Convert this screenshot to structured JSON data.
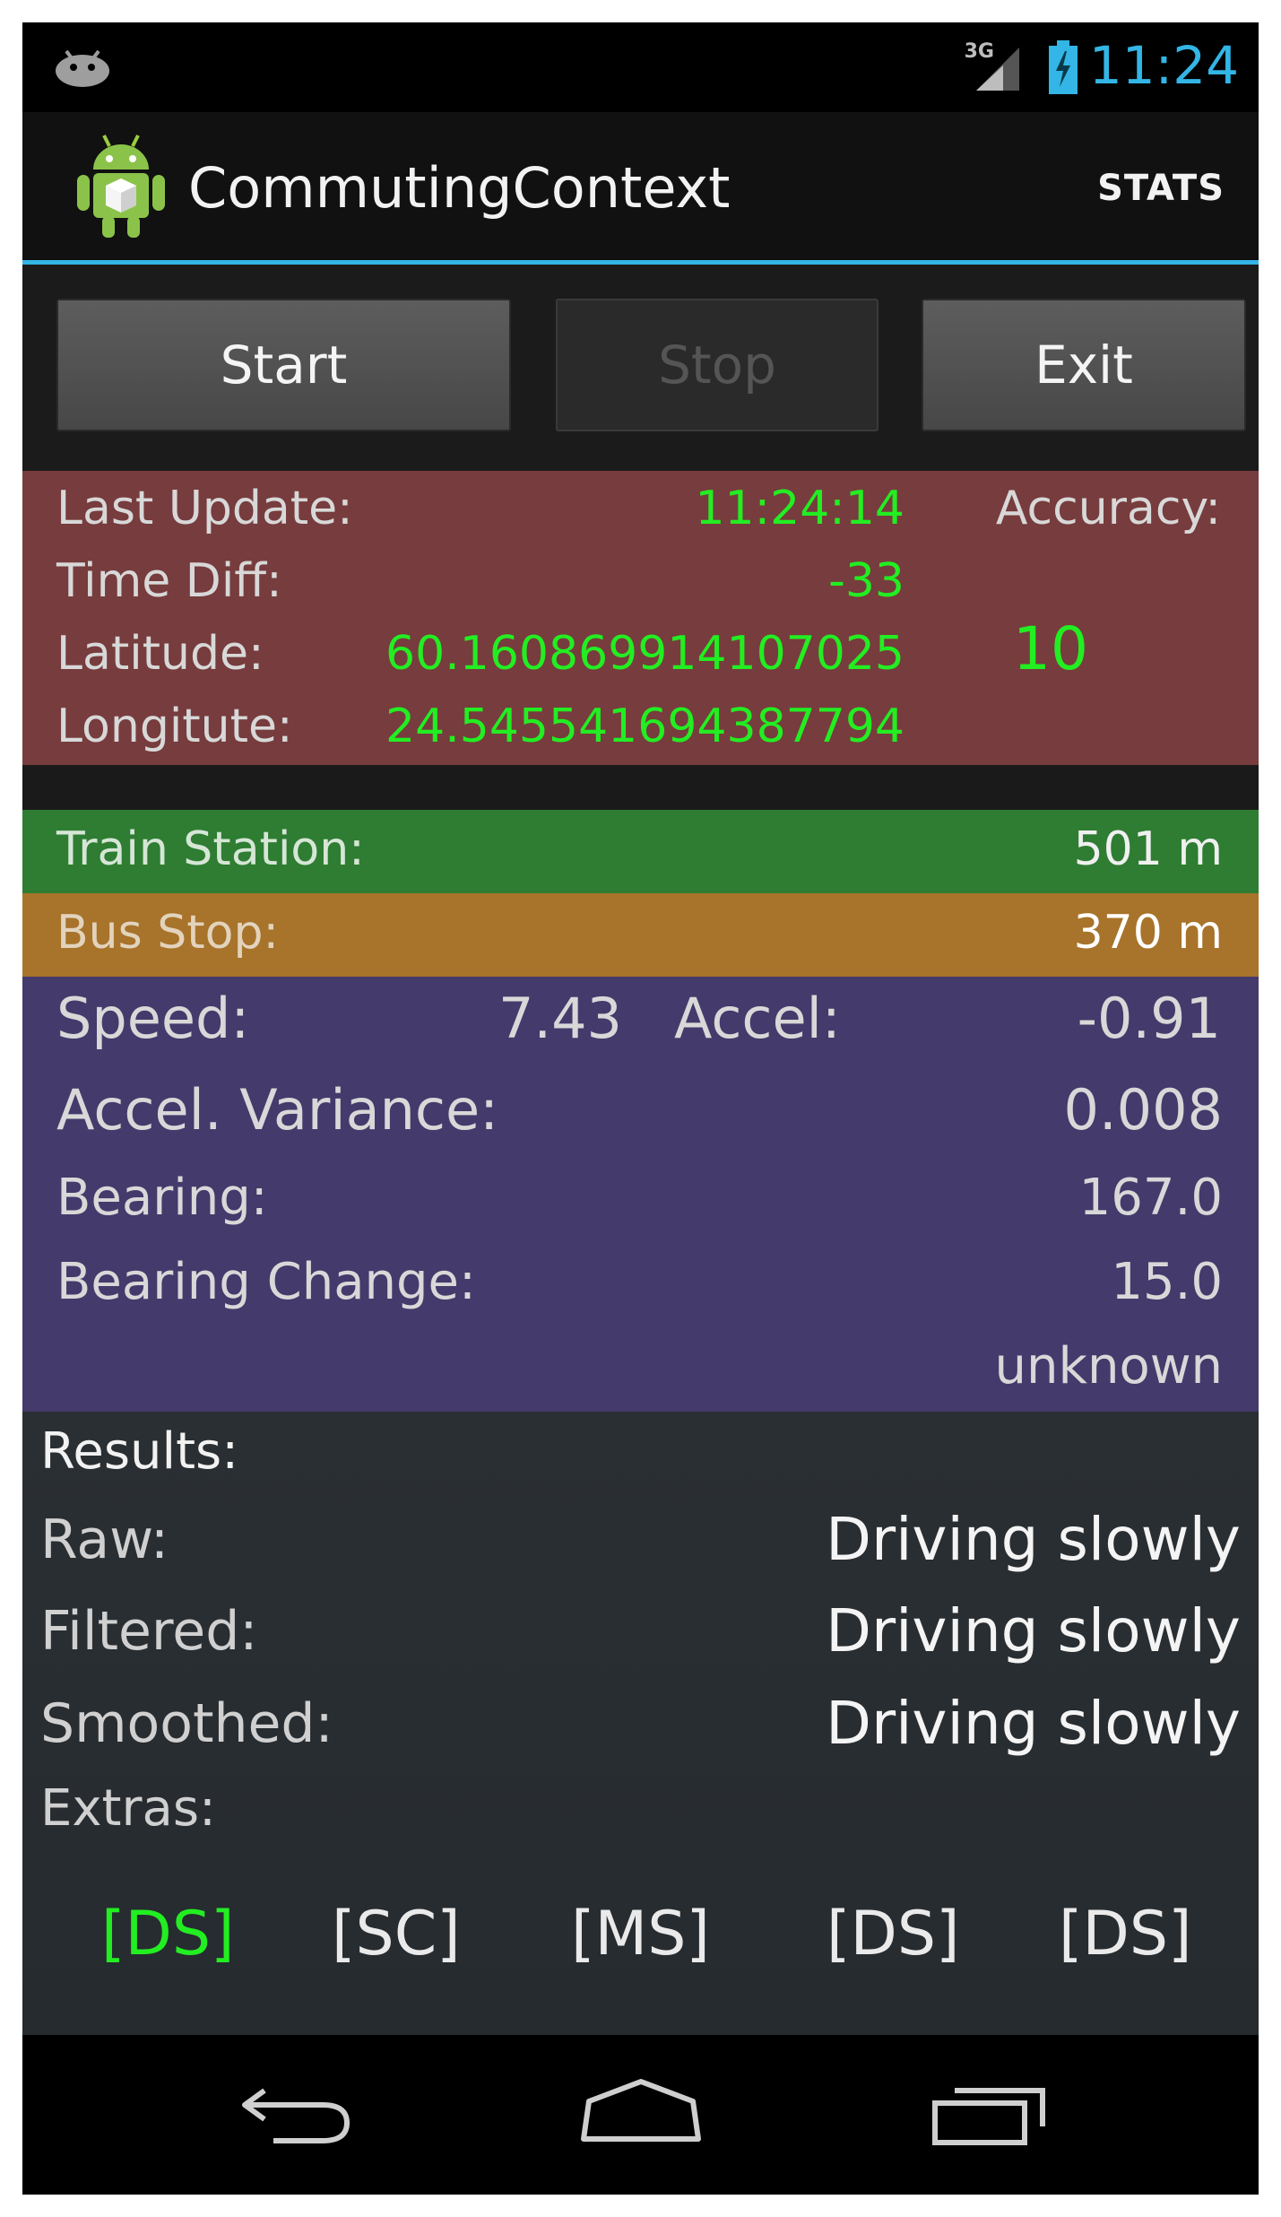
{
  "status_bar": {
    "network": "3G",
    "time": "11:24",
    "accent_color": "#33b5e5"
  },
  "action_bar": {
    "title": "CommutingContext",
    "stats_label": "STATS"
  },
  "controls": {
    "start": "Start",
    "stop": "Stop",
    "exit": "Exit"
  },
  "location": {
    "last_update_label": "Last Update:",
    "last_update_value": "11:24:14",
    "time_diff_label": "Time Diff:",
    "time_diff_value": "-33",
    "latitude_label": "Latitude:",
    "latitude_value": "60.160869914107025",
    "longitude_label": "Longitute:",
    "longitude_value": "24.545541694387794",
    "accuracy_label": "Accuracy:",
    "accuracy_value": "10"
  },
  "distances": {
    "train_label": "Train Station:",
    "train_value": "501 m",
    "bus_label": "Bus Stop:",
    "bus_value": "370 m"
  },
  "motion": {
    "speed_label": "Speed:",
    "speed_value": "7.43",
    "accel_label": "Accel:",
    "accel_value": "-0.91",
    "variance_label": "Accel. Variance:",
    "variance_value": "0.008",
    "bearing_label": "Bearing:",
    "bearing_value": "167.0",
    "bearing_change_label": "Bearing Change:",
    "bearing_change_value": "15.0",
    "state_value": "unknown"
  },
  "results": {
    "heading": "Results:",
    "raw_label": "Raw:",
    "raw_value": "Driving slowly",
    "filtered_label": "Filtered:",
    "filtered_value": "Driving slowly",
    "smoothed_label": "Smoothed:",
    "smoothed_value": "Driving slowly",
    "extras_label": "Extras:",
    "tags": [
      "[DS]",
      "[SC]",
      "[MS]",
      "[DS]",
      "[DS]"
    ]
  },
  "nav_bar": {
    "icons": [
      "back-icon",
      "home-icon",
      "recent-apps-icon"
    ]
  }
}
